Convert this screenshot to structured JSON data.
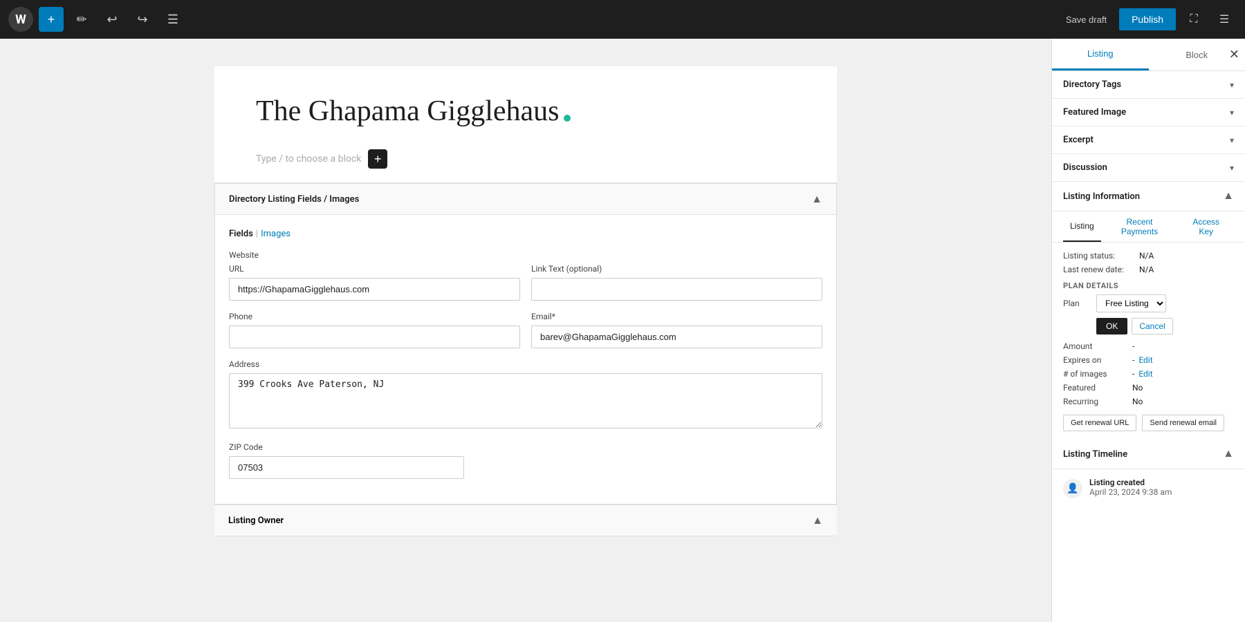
{
  "toolbar": {
    "wp_logo": "W",
    "add_label": "+",
    "edit_label": "✏",
    "undo_label": "↩",
    "redo_label": "↪",
    "menu_label": "☰",
    "save_draft_label": "Save draft",
    "publish_label": "Publish",
    "sidebar_toggle_label": "☰",
    "fullscreen_label": "⛶"
  },
  "editor": {
    "title": "The Ghapama Gigglehaus",
    "block_placeholder": "Type / to choose a block",
    "add_block_label": "+",
    "title_dot_color": "#1abc9c"
  },
  "directory_section": {
    "title": "Directory Listing Fields / Images",
    "collapse_icon": "▲",
    "sub_tabs": [
      {
        "label": "Fields",
        "active": true
      },
      {
        "label": "Images",
        "active": false
      }
    ],
    "website_label": "Website",
    "url_label": "URL",
    "url_value": "https://GhapamaGigglehaus.com",
    "link_text_label": "Link Text (optional)",
    "link_text_value": "",
    "phone_label": "Phone",
    "phone_value": "",
    "email_label": "Email*",
    "email_value": "barev@GhapamaGigglehaus.com",
    "address_label": "Address",
    "address_value": "399 Crooks Ave Paterson, NJ",
    "zip_label": "ZIP Code",
    "zip_value": "07503"
  },
  "listing_owner": {
    "title": "Listing Owner",
    "collapse_icon": "▲"
  },
  "right_sidebar": {
    "tab_listing": "Listing",
    "tab_block": "Block",
    "close_label": "✕",
    "active_tab": "Listing",
    "sections": [
      {
        "label": "Directory Tags",
        "chevron": "▾"
      },
      {
        "label": "Featured Image",
        "chevron": "▾"
      },
      {
        "label": "Excerpt",
        "chevron": "▾"
      },
      {
        "label": "Discussion",
        "chevron": "▾"
      }
    ],
    "listing_information": {
      "title": "Listing Information",
      "tabs": [
        {
          "label": "Listing",
          "active": true
        },
        {
          "label": "Recent Payments",
          "active": false
        },
        {
          "label": "Access Key",
          "active": false
        }
      ],
      "listing_status_label": "Listing status:",
      "listing_status_value": "N/A",
      "last_renew_label": "Last renew date:",
      "last_renew_value": "N/A",
      "plan_details_label": "PLAN DETAILS",
      "plan_label": "Plan",
      "plan_value": "Free Listing",
      "plan_chevron": "▾",
      "btn_ok": "OK",
      "btn_cancel": "Cancel",
      "amount_label": "Amount",
      "amount_value": "-",
      "expires_label": "Expires on",
      "expires_value": "-",
      "expires_edit": "Edit",
      "images_label": "# of images",
      "images_value": "-",
      "images_edit": "Edit",
      "featured_label": "Featured",
      "featured_value": "No",
      "recurring_label": "Recurring",
      "recurring_value": "No",
      "btn_get_renewal_url": "Get renewal URL",
      "btn_send_renewal_email": "Send renewal email"
    },
    "listing_timeline": {
      "title": "Listing Timeline",
      "event_label": "Listing created",
      "event_date": "April 23, 2024 9:38 am",
      "event_icon": "👤"
    }
  }
}
